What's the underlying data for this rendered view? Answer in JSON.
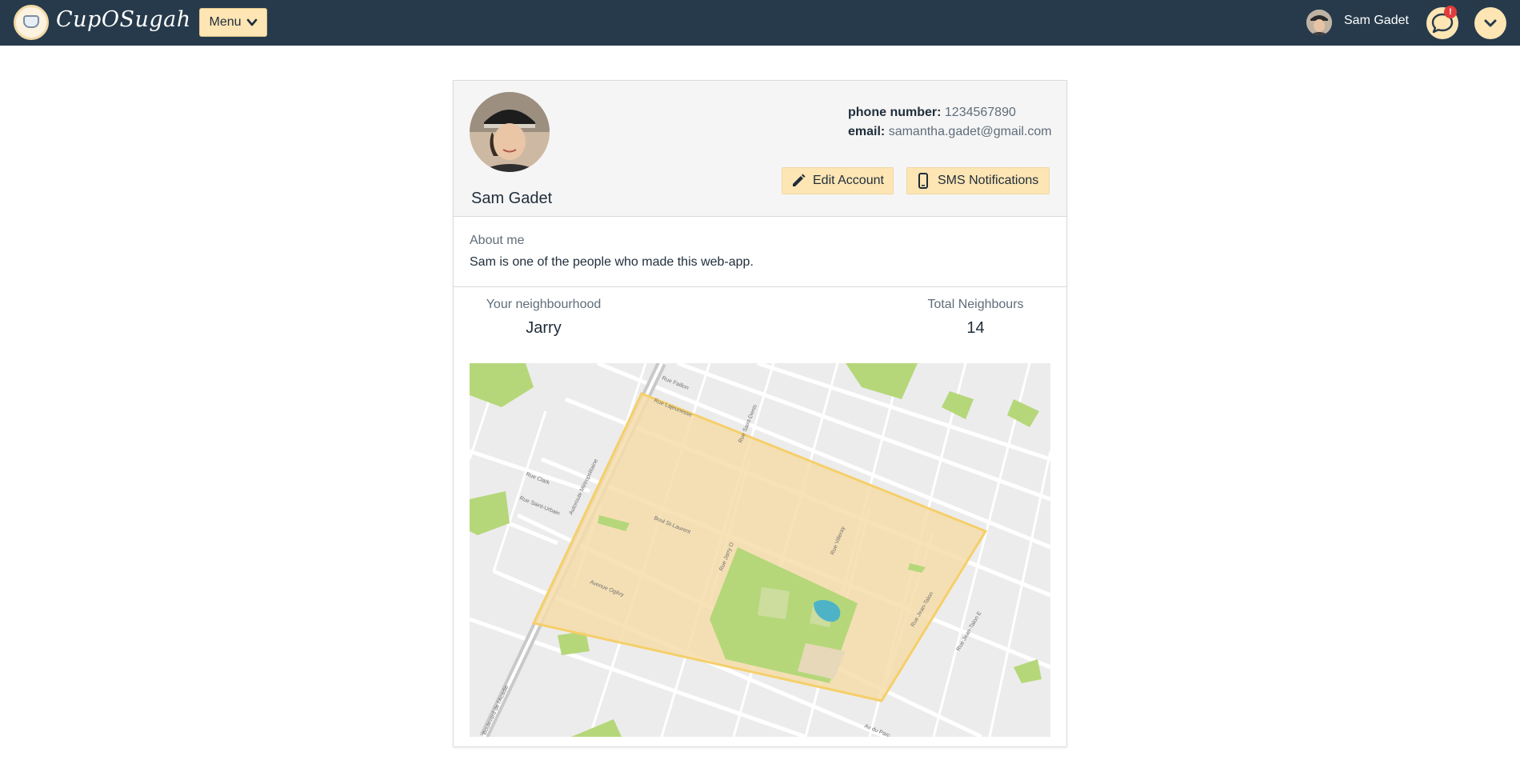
{
  "app": {
    "name": "CupOSugah",
    "menu_label": "Menu"
  },
  "header_user": {
    "name": "Sam Gadet",
    "notification_badge": "!"
  },
  "profile": {
    "name": "Sam Gadet",
    "phone_label": "phone number:",
    "phone_value": "1234567890",
    "email_label": "email:",
    "email_value": "samantha.gadet@gmail.com",
    "edit_button": "Edit Account",
    "sms_button": "SMS Notifications",
    "about_label": "About me",
    "about_text": "Sam is one of the people who made this web-app."
  },
  "stats": {
    "neighbourhood_label": "Your neighbourhood",
    "neighbourhood_value": "Jarry",
    "total_label": "Total Neighbours",
    "total_value": "14"
  },
  "map": {
    "street_labels": [
      "Rue Lajeunesse",
      "Boul St-Laurent",
      "Autoroute Métropolitaine",
      "Rue Jarry O",
      "Rue Villeray",
      "Rue Saint-Denis",
      "Rue Faillon",
      "Rue Jean-Talon",
      "Avenue Ogilvy",
      "Rue Clark",
      "Rue Saint-Urbain",
      "Rue Jean-Talon E",
      "Boulevard de l'Acadie",
      "Av du Parc"
    ]
  },
  "icons": {
    "menu_chevron": "chevron-down-icon",
    "chat": "chat-bubble-icon",
    "dropdown": "chevron-down-icon",
    "edit": "pencil-icon",
    "sms": "mobile-phone-icon"
  },
  "colors": {
    "nav_background": "#263a4b",
    "accent": "#fde5b4",
    "badge": "#e23b3b",
    "neighbourhood_fill": "#f6ddaa",
    "park": "#b5d77a",
    "water": "#4fb3c8"
  }
}
